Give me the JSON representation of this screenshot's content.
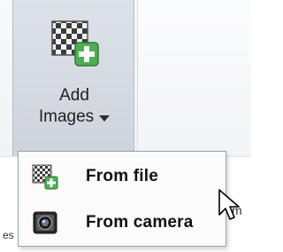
{
  "add_images_button": {
    "label_line1": "Add",
    "label_line2": "Images",
    "icon": "add-image-icon",
    "dropdown_indicator": "chevron-down-icon",
    "state": "pressed"
  },
  "dropdown_menu": {
    "items": [
      {
        "label": "From file",
        "icon": "add-image-icon"
      },
      {
        "label": "From camera",
        "icon": "camera-icon"
      }
    ]
  },
  "background_text": {
    "left_fragment": "es",
    "right_fragment": "m"
  },
  "colors": {
    "accent_green": "#5cb85c",
    "button_pressed_bg": "#d4d9e1",
    "menu_border": "#9aa3ae"
  }
}
